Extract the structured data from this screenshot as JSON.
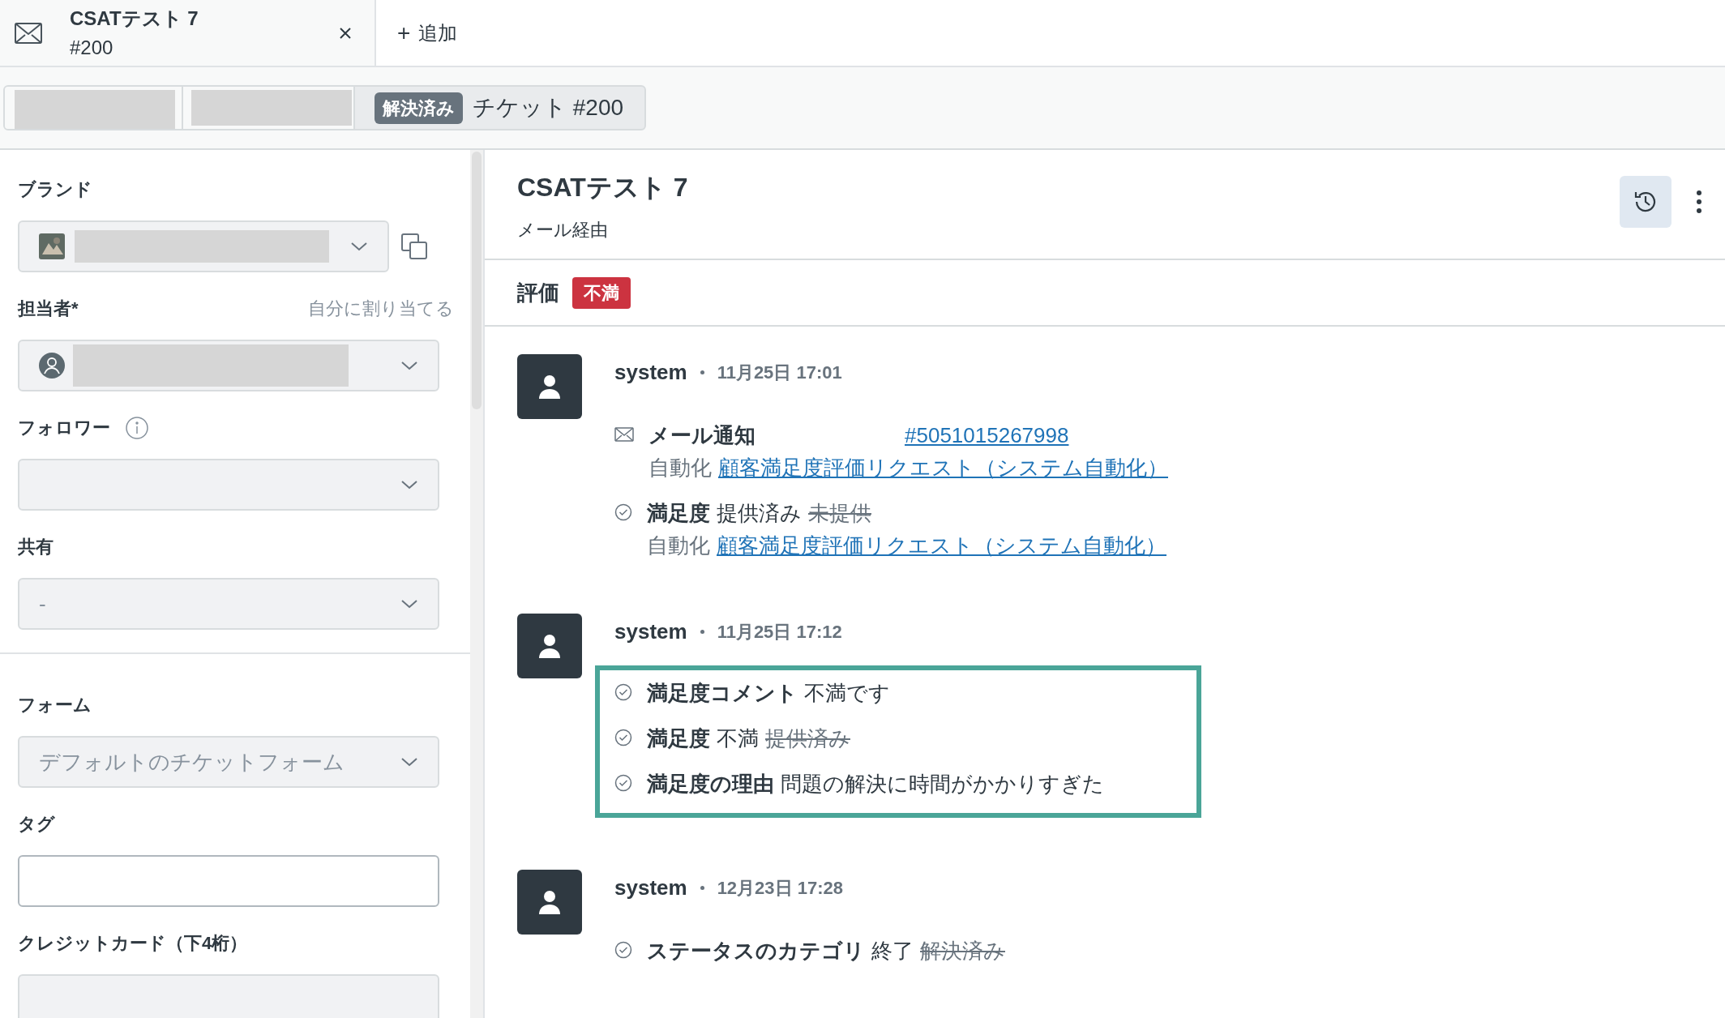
{
  "tabs": [
    {
      "title": "CSATテスト 7",
      "subtitle": "#200",
      "selected": true
    }
  ],
  "add_tab": {
    "icon": "+",
    "label": "追加"
  },
  "breadcrumb": {
    "status": "解決済み",
    "ticket": "チケット #200"
  },
  "sidebar": {
    "fields": [
      {
        "kind": "brand",
        "label": "ブランド"
      },
      {
        "kind": "assignee",
        "label": "担当者*",
        "action": "自分に割り当てる"
      },
      {
        "kind": "select",
        "label": "フォロワー",
        "info": true
      },
      {
        "kind": "select",
        "label": "共有",
        "value": "-"
      },
      {
        "kind": "divider"
      },
      {
        "kind": "select",
        "label": "フォーム",
        "value": "デフォルトのチケットフォーム"
      },
      {
        "kind": "input",
        "label": "タグ"
      },
      {
        "kind": "disabled",
        "label": "クレジットカード（下4桁）"
      }
    ]
  },
  "ticket": {
    "title": "CSATテスト 7",
    "channel": "メール経由",
    "rating_label": "評価",
    "rating": "不満"
  },
  "events": [
    {
      "author": "system",
      "time": "11月25日 17:01",
      "highlighted": false,
      "items": [
        {
          "kind": "mail",
          "label": "メール通知",
          "link": "#5051015267998",
          "via": "自動化",
          "via_link": "顧客満足度評価リクエスト（システム自動化）"
        },
        {
          "kind": "change",
          "label": "満足度",
          "value": "提供済み",
          "old": "未提供",
          "via": "自動化",
          "via_link": "顧客満足度評価リクエスト（システム自動化）"
        }
      ]
    },
    {
      "author": "system",
      "time": "11月25日 17:12",
      "highlighted": true,
      "items": [
        {
          "kind": "change",
          "label": "満足度コメント",
          "value": "不満です"
        },
        {
          "kind": "change",
          "label": "満足度",
          "value": "不満",
          "old": "提供済み"
        },
        {
          "kind": "change",
          "label": "満足度の理由",
          "value": "問題の解決に時間がかかりすぎた"
        }
      ]
    },
    {
      "author": "system",
      "time": "12月23日 17:28",
      "highlighted": false,
      "items": [
        {
          "kind": "change",
          "label": "ステータスのカテゴリ",
          "value": "終了",
          "old": "解決済み"
        }
      ]
    }
  ]
}
